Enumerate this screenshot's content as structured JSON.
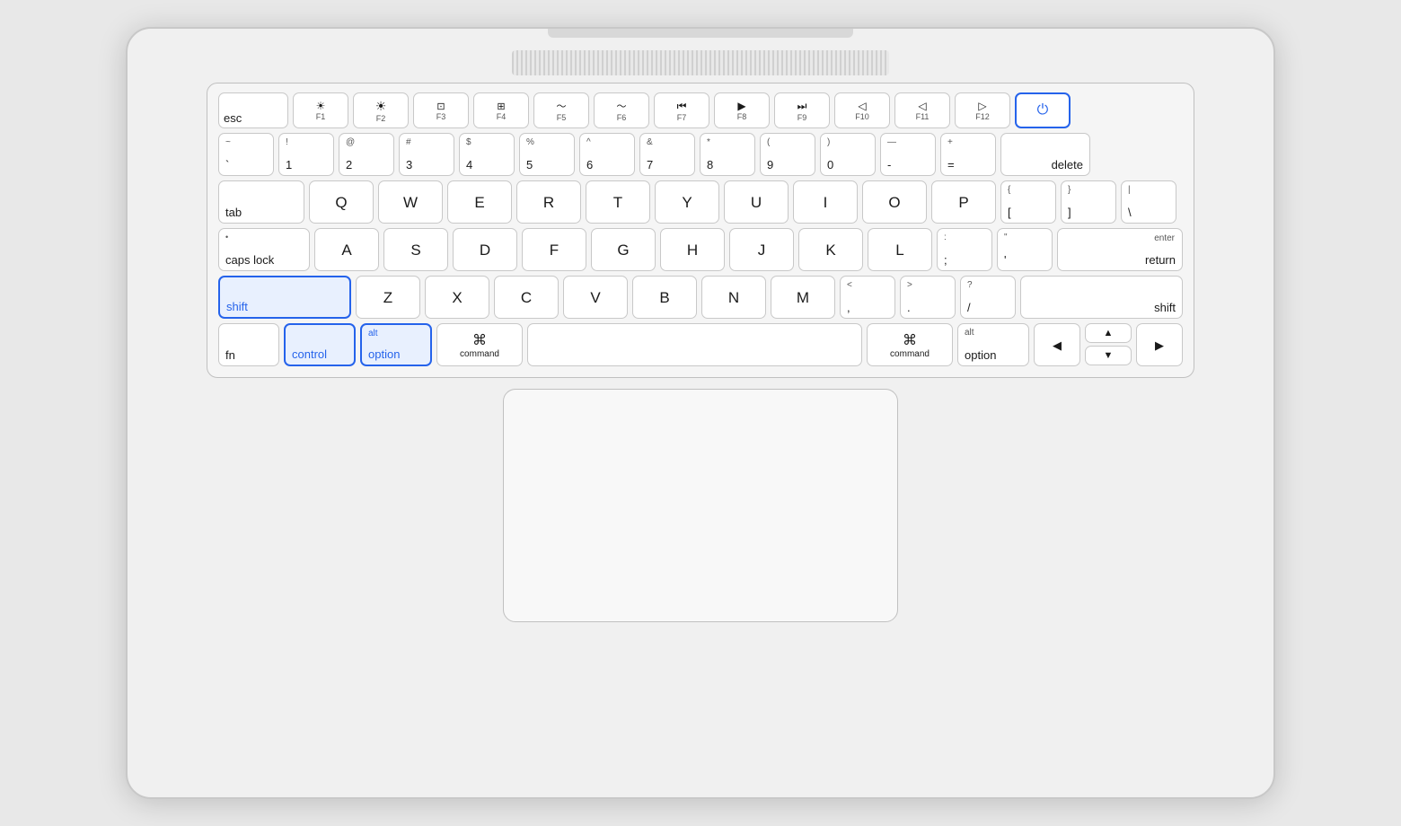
{
  "keyboard": {
    "rows": {
      "fn_row": {
        "esc": "esc",
        "f1_icon": "☀",
        "f1": "F1",
        "f2_icon": "☀",
        "f2": "F2",
        "f3_icon": "⊞",
        "f3": "F3",
        "f4_icon": "⊞",
        "f4": "F4",
        "f5_icon": "~",
        "f5": "F5",
        "f6_icon": "~",
        "f6": "F6",
        "f7_icon": "⏮",
        "f7": "F7",
        "f8_icon": "▶",
        "f8": "F8",
        "f9_icon": "⏭",
        "f9": "F9",
        "f10_icon": "◁",
        "f10": "F10",
        "f11_icon": "◁",
        "f11": "F11",
        "f12_icon": "▷",
        "f12": "F12",
        "power_icon": "⏻"
      },
      "num_row": {
        "tilde": "~",
        "backtick": "`",
        "n1_top": "!",
        "n1": "1",
        "n2_top": "@",
        "n2": "2",
        "n3_top": "#",
        "n3": "3",
        "n4_top": "$",
        "n4": "4",
        "n5_top": "%",
        "n5": "5",
        "n6_top": "^",
        "n6": "6",
        "n7_top": "&",
        "n7": "7",
        "n8_top": "*",
        "n8": "8",
        "n9_top": "(",
        "n9": "9",
        "n0_top": ")",
        "n0": "0",
        "minus_top": "—",
        "minus": "-",
        "plus_top": "+",
        "plus": "=",
        "delete": "delete"
      },
      "qwerty": {
        "tab": "tab",
        "q": "Q",
        "w": "W",
        "e": "E",
        "r": "R",
        "t": "T",
        "y": "Y",
        "u": "U",
        "i": "I",
        "o": "O",
        "p": "P",
        "open_brace_top": "{",
        "open_brace": "[",
        "close_brace_top": "}",
        "close_brace": "]",
        "pipe_top": "|",
        "pipe": "\\"
      },
      "home_row": {
        "caps_dot": "•",
        "caps": "caps lock",
        "a": "A",
        "s": "S",
        "d": "D",
        "f": "F",
        "g": "G",
        "h": "H",
        "j": "J",
        "k": "K",
        "l": "L",
        "colon_top": ":",
        "colon": ";",
        "quote_top": "\"",
        "quote": "'",
        "enter_top": "enter",
        "enter_bottom": "return"
      },
      "shift_row": {
        "shift_l": "shift",
        "z": "Z",
        "x": "X",
        "c": "C",
        "v": "V",
        "b": "B",
        "n": "N",
        "m": "M",
        "lt_top": "<",
        "lt": ",",
        "gt_top": ">",
        "gt": ".",
        "question_top": "?",
        "question": "/",
        "shift_r": "shift"
      },
      "bottom_row": {
        "fn": "fn",
        "control": "control",
        "alt_option_top": "alt",
        "alt_option": "option",
        "command_l_icon": "⌘",
        "command_l": "command",
        "space": "",
        "command_r_icon": "⌘",
        "command_r": "command",
        "alt_r_top": "alt",
        "alt_r": "option",
        "arrow_left": "◀",
        "arrow_up": "▲",
        "arrow_down": "▼",
        "arrow_right": "▶"
      }
    }
  }
}
